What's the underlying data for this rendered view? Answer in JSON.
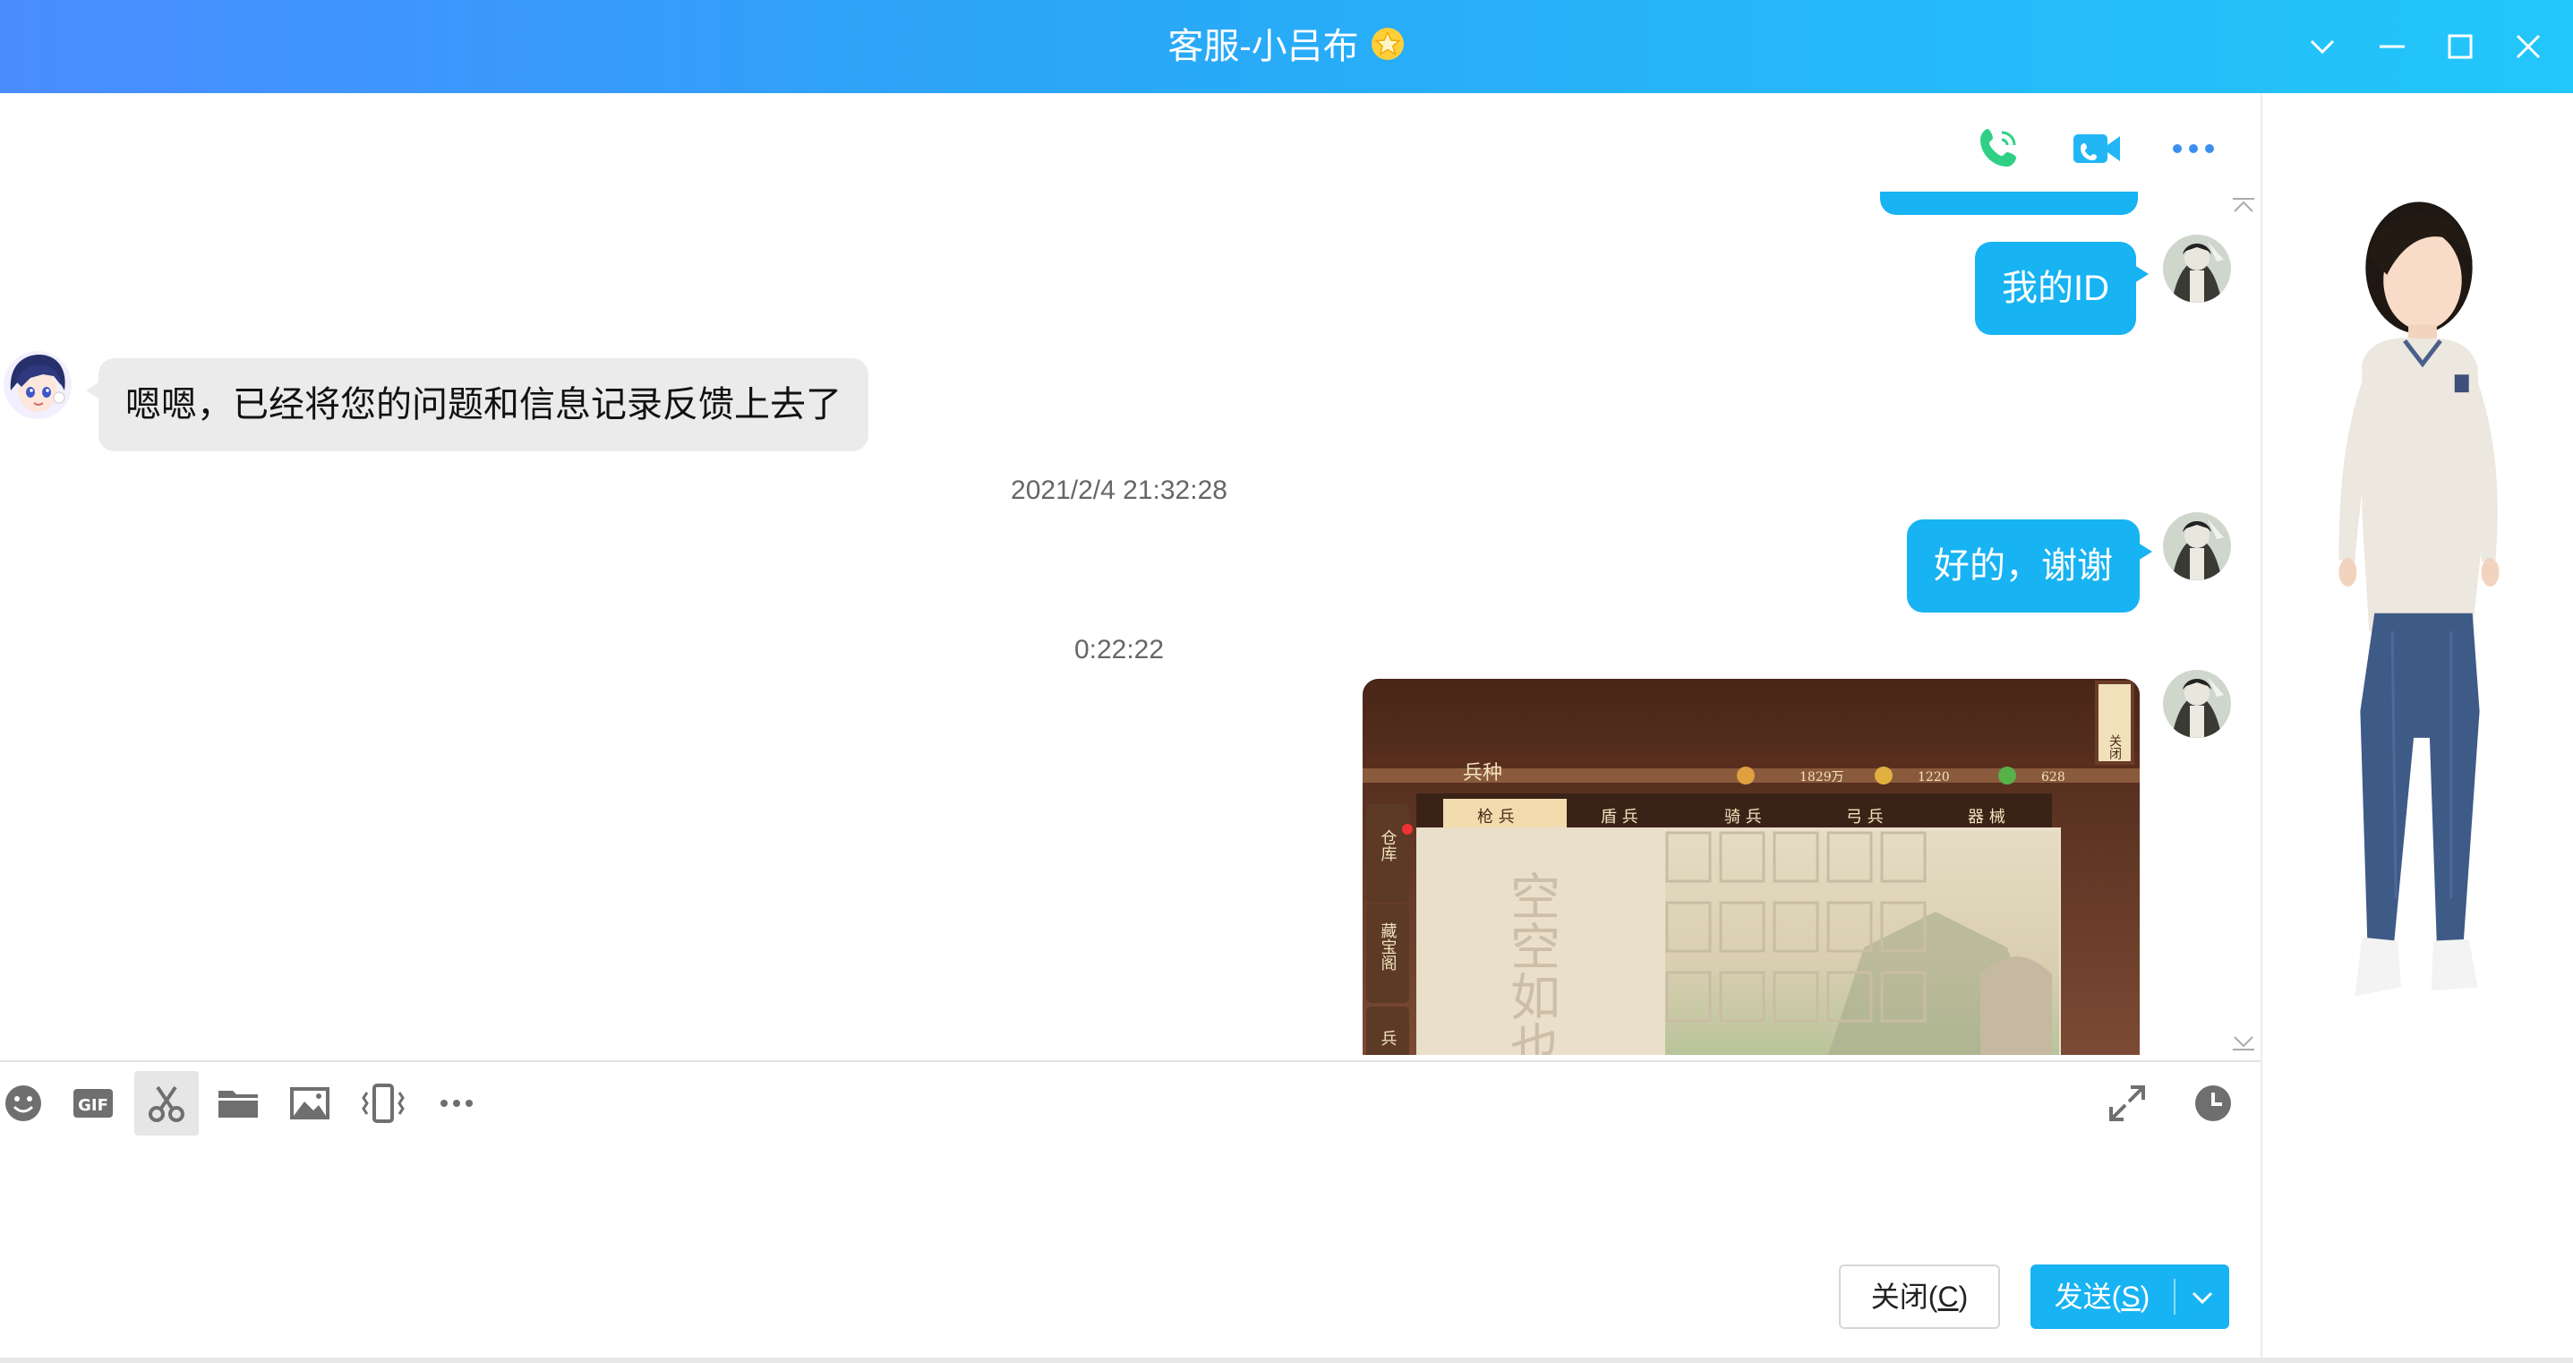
{
  "window": {
    "title": "客服-小吕布",
    "title_icon": "star-badge-icon",
    "controls": [
      "chevron-down-icon",
      "minimize-icon",
      "maximize-icon",
      "close-icon"
    ]
  },
  "header_actions": [
    "phone-call-icon",
    "video-call-icon",
    "more-icon"
  ],
  "messages": [
    {
      "side": "right",
      "text": "我的ID"
    },
    {
      "side": "left",
      "text": "嗯嗯，已经将您的问题和信息记录反馈上去了"
    },
    {
      "timestamp": "2021/2/4 21:32:28"
    },
    {
      "side": "right",
      "text": "好的，谢谢"
    },
    {
      "timestamp": "0:22:22"
    },
    {
      "side": "right",
      "type": "image"
    }
  ],
  "screenshot_text": {
    "title": "兵种",
    "close_tag": "关闭",
    "stats": [
      "1829万",
      "1220",
      "628"
    ],
    "tabs": [
      "枪 兵",
      "盾 兵",
      "骑 兵",
      "弓 兵",
      "器 械"
    ],
    "side_tabs": [
      "仓库",
      "藏宝阁",
      "兵"
    ],
    "empty_text": "空空如也"
  },
  "toolbar": {
    "left_tools": [
      "emoji-icon",
      "gif-icon",
      "scissors-icon",
      "folder-icon",
      "image-icon",
      "shake-icon",
      "more-tools-icon"
    ],
    "right_tools": [
      "expand-icon",
      "history-clock-icon"
    ]
  },
  "buttons": {
    "close_label": "关闭",
    "close_key": "C",
    "send_label": "发送",
    "send_key": "S"
  },
  "colors": {
    "accent": "#17b3f3",
    "title_gradient_start": "#4a8cff",
    "title_gradient_end": "#22c7fb",
    "left_bubble": "#ebebeb"
  }
}
